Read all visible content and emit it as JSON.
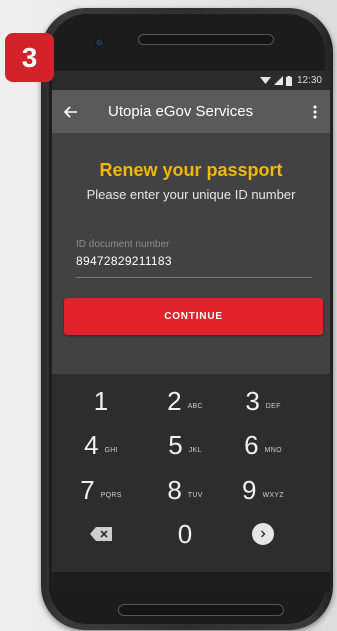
{
  "step_badge": "3",
  "statusbar": {
    "time": "12:30"
  },
  "appbar": {
    "title": "Utopia eGov Services"
  },
  "content": {
    "title": "Renew your passport",
    "subtitle": "Please enter your unique ID number",
    "field_label": "ID document number",
    "field_value": "89472829211183",
    "continue_label": "CONTINUE"
  },
  "keypad": [
    {
      "num": "1",
      "letters": ""
    },
    {
      "num": "2",
      "letters": "ABC"
    },
    {
      "num": "3",
      "letters": "DEF"
    },
    {
      "num": "4",
      "letters": "GHI"
    },
    {
      "num": "5",
      "letters": "JKL"
    },
    {
      "num": "6",
      "letters": "MNO"
    },
    {
      "num": "7",
      "letters": "PQRS"
    },
    {
      "num": "8",
      "letters": "TUV"
    },
    {
      "num": "9",
      "letters": "WXYZ"
    },
    {
      "num": "0",
      "letters": ""
    }
  ],
  "colors": {
    "accent_yellow": "#f3b700",
    "button_red": "#e3232b",
    "badge_red": "#d2232a"
  }
}
